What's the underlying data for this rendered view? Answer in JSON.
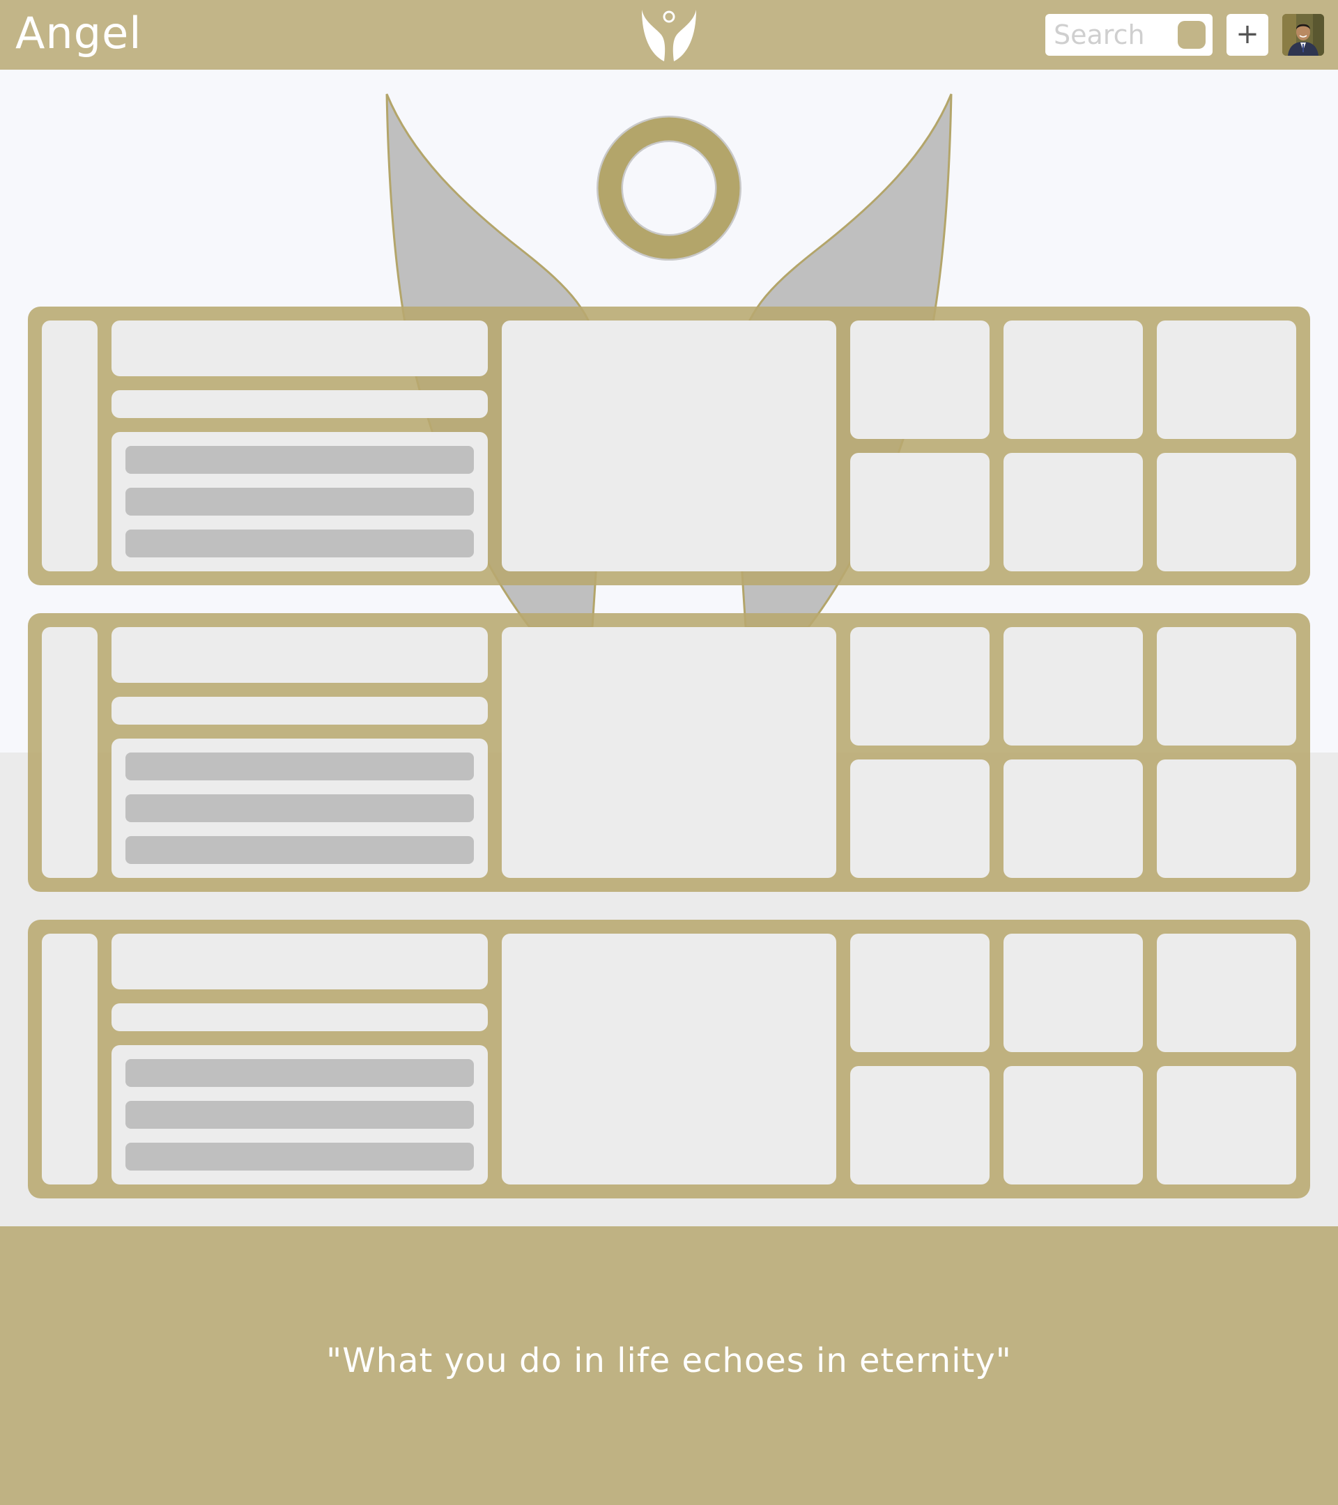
{
  "header": {
    "brand": "Angel",
    "search_placeholder": "Search",
    "add_label": "+"
  },
  "footer": {
    "quote": "\"What you do in life echoes in eternity\""
  },
  "colors": {
    "gold": "#c2b588",
    "gold_dark": "#b8a870",
    "panel": "#ececec",
    "bar": "#bfbfbf",
    "hero_bg": "#f7f8fc",
    "page_bg": "#ebebeb",
    "footer": "#bfb283"
  },
  "icons": {
    "top_logo": "angel-logo-icon",
    "hero_logo": "angel-logo-icon",
    "add": "plus-icon",
    "avatar": "user-avatar"
  }
}
